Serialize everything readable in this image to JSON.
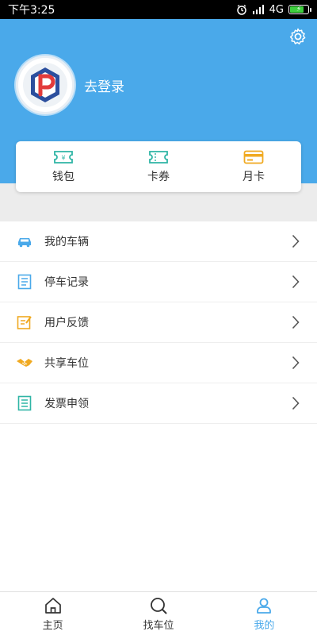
{
  "status_bar": {
    "time": "下午3:25",
    "network": "4G"
  },
  "profile": {
    "login_text": "去登录"
  },
  "wallet": {
    "items": [
      {
        "label": "钱包",
        "icon": "wallet-ticket-icon"
      },
      {
        "label": "卡券",
        "icon": "coupon-icon"
      },
      {
        "label": "月卡",
        "icon": "monthly-card-icon"
      }
    ]
  },
  "menu": {
    "items": [
      {
        "label": "我的车辆",
        "icon": "car-icon"
      },
      {
        "label": "停车记录",
        "icon": "parking-record-icon"
      },
      {
        "label": "用户反馈",
        "icon": "feedback-icon"
      },
      {
        "label": "共享车位",
        "icon": "handshake-icon"
      },
      {
        "label": "发票申领",
        "icon": "invoice-icon"
      }
    ]
  },
  "tabbar": {
    "tabs": [
      {
        "label": "主页",
        "icon": "home-icon"
      },
      {
        "label": "找车位",
        "icon": "search-icon"
      },
      {
        "label": "我的",
        "icon": "user-icon"
      }
    ],
    "active": "我的"
  },
  "colors": {
    "primary": "#4aa9ea",
    "band": "#ececec"
  }
}
